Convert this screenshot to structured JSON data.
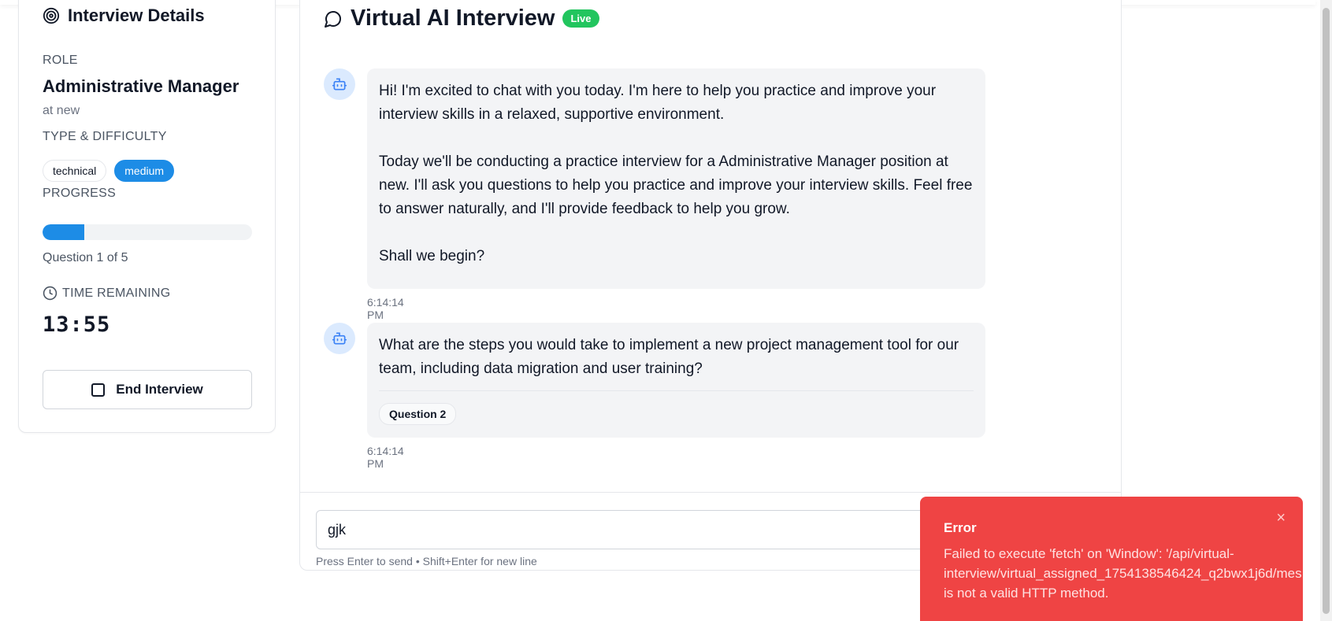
{
  "sidebar": {
    "title": "Interview Details",
    "role_label": "ROLE",
    "role_name": "Administrative Manager",
    "company": "at new",
    "type_label": "TYPE & DIFFICULTY",
    "type_tag": "technical",
    "difficulty_tag": "medium",
    "progress_label": "PROGRESS",
    "progress_fraction": 0.2,
    "question_count": "Question 1 of 5",
    "time_label": "TIME REMAINING",
    "timer": "13:55",
    "end_button": "End Interview"
  },
  "main": {
    "title": "Virtual AI Interview",
    "live_badge": "Live",
    "messages": [
      {
        "paragraphs": [
          "Hi! I'm excited to chat with you today. I'm here to help you practice and improve your interview skills in a relaxed, supportive environment.",
          "Today we'll be conducting a practice interview for a Administrative Manager position at new. I'll ask you questions to help you practice and improve your interview skills. Feel free to answer naturally, and I'll provide feedback to help you grow.",
          "Shall we begin?"
        ],
        "timestamp": "6:14:14 PM"
      },
      {
        "text": "What are the steps you would take to implement a new project management tool for our team, including data migration and user training?",
        "tag": "Question 2",
        "timestamp": "6:14:14 PM"
      }
    ],
    "input_value": "gjk",
    "hint": "Press Enter to send • Shift+Enter for new line"
  },
  "toast": {
    "title": "Error",
    "line1": "Failed to execute 'fetch' on 'Window': '/api/virtual-",
    "line2": "interview/virtual_assigned_1754138546424_q2bwx1j6d/mes",
    "line3": "is not a valid HTTP method.",
    "close": "×"
  },
  "colors": {
    "accent": "#1d8ce6",
    "live": "#22c55e",
    "error": "#ef4444"
  }
}
